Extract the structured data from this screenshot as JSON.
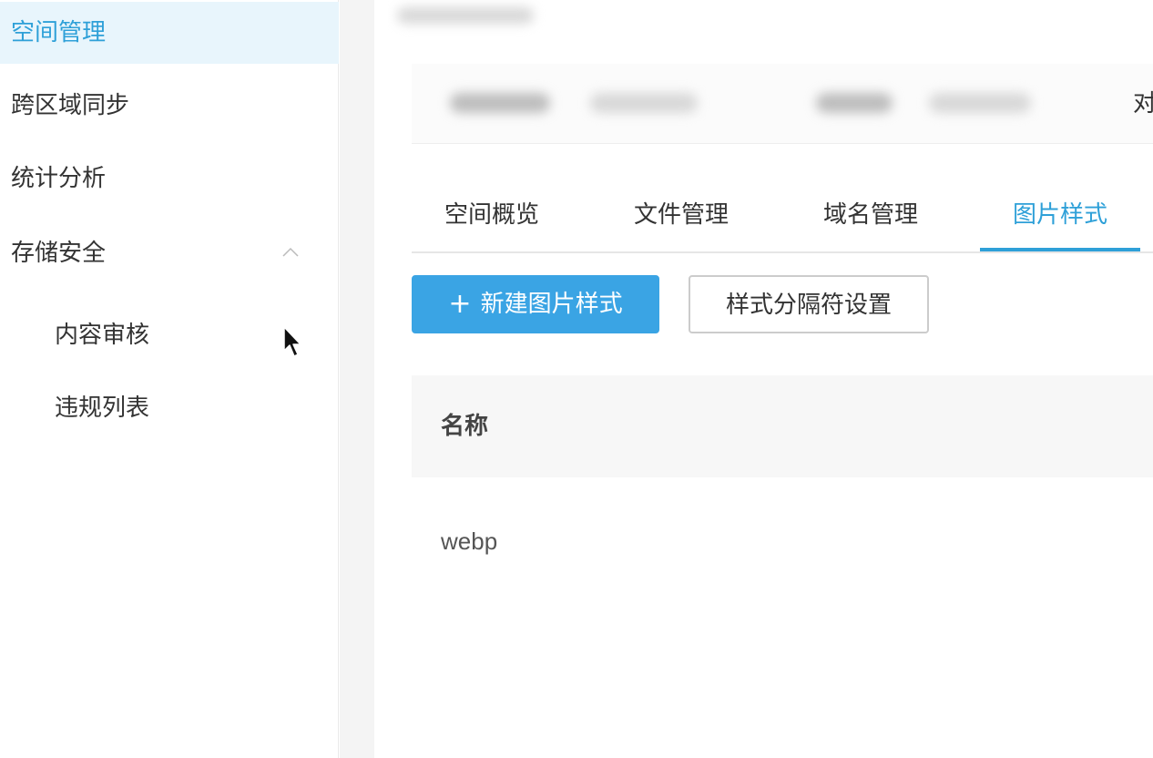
{
  "sidebar": {
    "items": [
      {
        "label": "空间管理"
      },
      {
        "label": "跨区域同步"
      },
      {
        "label": "统计分析"
      },
      {
        "label": "存储安全"
      }
    ],
    "subitems": [
      {
        "label": "内容审核"
      },
      {
        "label": "违规列表"
      }
    ]
  },
  "header": {
    "partial_char": "对"
  },
  "tabs": [
    {
      "label": "空间概览"
    },
    {
      "label": "文件管理"
    },
    {
      "label": "域名管理"
    },
    {
      "label": "图片样式"
    }
  ],
  "toolbar": {
    "plus": "+",
    "create_label": "新建图片样式",
    "separator_label": "样式分隔符设置"
  },
  "table": {
    "columns": [
      "名称"
    ],
    "rows": [
      [
        "webp"
      ]
    ]
  },
  "colors": {
    "accent": "#2ea0d8",
    "primary_button": "#3aa4e4"
  }
}
